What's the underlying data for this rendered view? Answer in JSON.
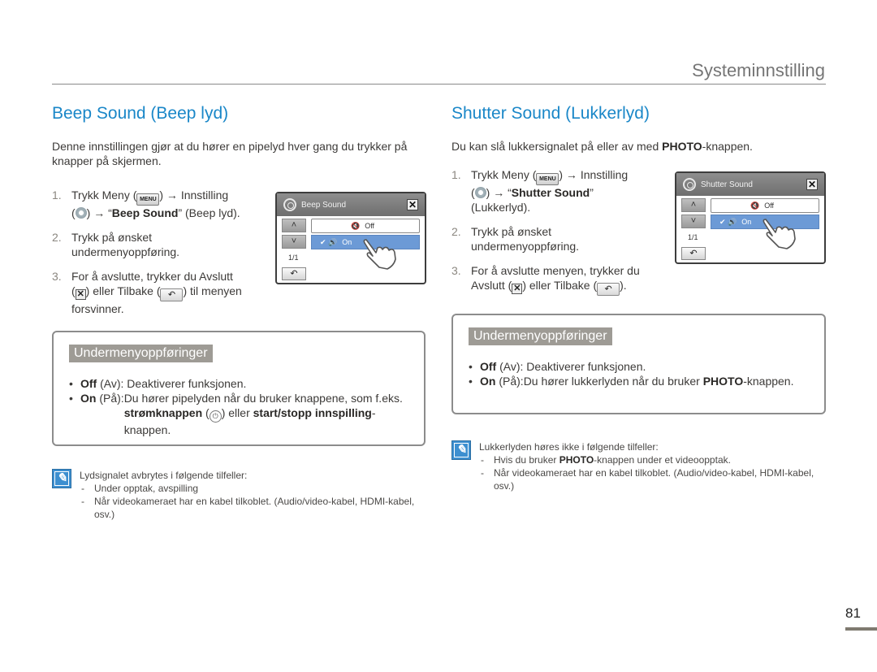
{
  "header": {
    "title": "Systeminnstilling"
  },
  "beep": {
    "title": "Beep Sound (Beep lyd)",
    "intro": "Denne innstillingen gjør at du hører en pipelyd hver gang du trykker på knapper på skjermen.",
    "steps": [
      {
        "num": "1.",
        "parts": {
          "a": "Trykk Meny (",
          "menu_key": "MENU",
          "b": ") → Innstilling",
          "c": "(",
          "d": ") → “",
          "bold": "Beep Sound",
          "e": "” (Beep lyd)."
        }
      },
      {
        "num": "2.",
        "text": "Trykk på ønsket undermenyoppføring."
      },
      {
        "num": "3.",
        "parts": {
          "a": "For å avslutte, trykker du Avslutt",
          "b": "(",
          "c": ") eller Tilbake (",
          "d": ") til menyen forsvinner."
        }
      }
    ],
    "screen": {
      "title": "Beep Sound",
      "options": [
        {
          "label": "Off",
          "selected": false
        },
        {
          "label": "On",
          "selected": true
        }
      ],
      "page": "1/1",
      "up_icon": "chevron-up-icon",
      "down_icon": "chevron-down-icon",
      "back_icon": "back-arrow-icon",
      "close_icon": "close-icon"
    },
    "submenu": {
      "label": "Undermenyoppføringer",
      "items": [
        {
          "term": "Off",
          "paren": " (Av): ",
          "desc": "Deaktiverer funksjonen."
        },
        {
          "term": "On",
          "paren": " (På): ",
          "desc_a": "Du hører pipelyden når du bruker knappene, som f.eks. ",
          "bold1": "strømknappen",
          "desc_b": " (",
          "desc_c": ") eller ",
          "bold2": "start/stopp innspilling",
          "desc_d": "-knappen."
        }
      ]
    },
    "note": {
      "intro": "Lydsignalet avbrytes i følgende tilfeller:",
      "items": [
        "Under opptak, avspilling",
        "Når videokameraet har en kabel tilkoblet. (Audio/video-kabel, HDMI-kabel, osv.)"
      ]
    }
  },
  "shutter": {
    "title": "Shutter Sound (Lukkerlyd)",
    "intro": {
      "a": "Du kan slå lukkersignalet på eller av med ",
      "bold": "PHOTO",
      "b": "-knappen."
    },
    "steps": [
      {
        "num": "1.",
        "parts": {
          "a": "Trykk Meny (",
          "menu_key": "MENU",
          "b": ") → Innstilling",
          "c": "(",
          "d": ") → “",
          "bold": "Shutter Sound",
          "e": "” (Lukkerlyd)."
        }
      },
      {
        "num": "2.",
        "text": "Trykk på ønsket undermenyoppføring."
      },
      {
        "num": "3.",
        "parts": {
          "a": "For å avslutte menyen, trykker du Avslutt (",
          "c": ") eller Tilbake (",
          "d": ")."
        }
      }
    ],
    "screen": {
      "title": "Shutter Sound",
      "options": [
        {
          "label": "Off",
          "selected": false
        },
        {
          "label": "On",
          "selected": true
        }
      ],
      "page": "1/1"
    },
    "submenu": {
      "label": "Undermenyoppføringer",
      "items": [
        {
          "term": "Off",
          "paren": " (Av): ",
          "desc": "Deaktiverer funksjonen."
        },
        {
          "term": "On",
          "paren": " (På): ",
          "desc_a": "Du hører lukkerlyden når du bruker ",
          "bold1": "PHOTO",
          "desc_b": "-knappen."
        }
      ]
    },
    "note": {
      "intro": "Lukkerlyden høres ikke i følgende tilfeller:",
      "items": [
        {
          "a": "Hvis du bruker ",
          "bold": "PHOTO",
          "b": "-knappen under et videoopptak."
        },
        {
          "text": "Når videokameraet har en kabel tilkoblet. (Audio/video-kabel, HDMI-kabel, osv.)"
        }
      ]
    }
  },
  "symbols": {
    "arrow_up": "˄",
    "arrow_down": "˅",
    "back": "↶",
    "close": "✕",
    "check": "✔",
    "speaker": "🔈",
    "power": "⏻",
    "dash": "-",
    "bullet": "•"
  },
  "colors": {
    "accent": "#1a87c8",
    "selected_option": "#6c9ad6",
    "submenu_label_bg": "#9e9b95"
  },
  "footer": {
    "page_number": "81"
  }
}
